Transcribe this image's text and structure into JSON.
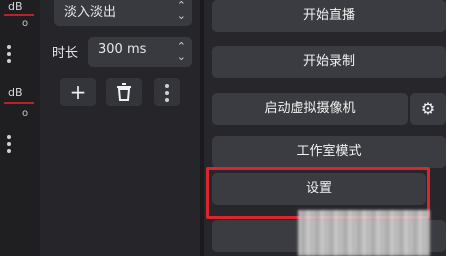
{
  "mixer": {
    "channels": [
      {
        "level": "dB",
        "sub": "o"
      },
      {
        "level": "dB",
        "sub": "o"
      }
    ]
  },
  "transitions": {
    "type_value": "淡入淡出",
    "duration_label": "时长",
    "duration_value": "300 ms",
    "add_icon": "plus-icon",
    "remove_icon": "trash-icon",
    "more_icon": "more-vertical-icon"
  },
  "controls": {
    "start_streaming": "开始直播",
    "start_recording": "开始录制",
    "start_virtual_camera": "启动虚拟摄像机",
    "virtual_camera_settings_icon": "gear-icon",
    "studio_mode": "工作室模式",
    "settings": "设置"
  },
  "colors": {
    "highlight": "#d9262f",
    "panel_bg": "#26262b",
    "button_bg": "#3b3c42"
  }
}
